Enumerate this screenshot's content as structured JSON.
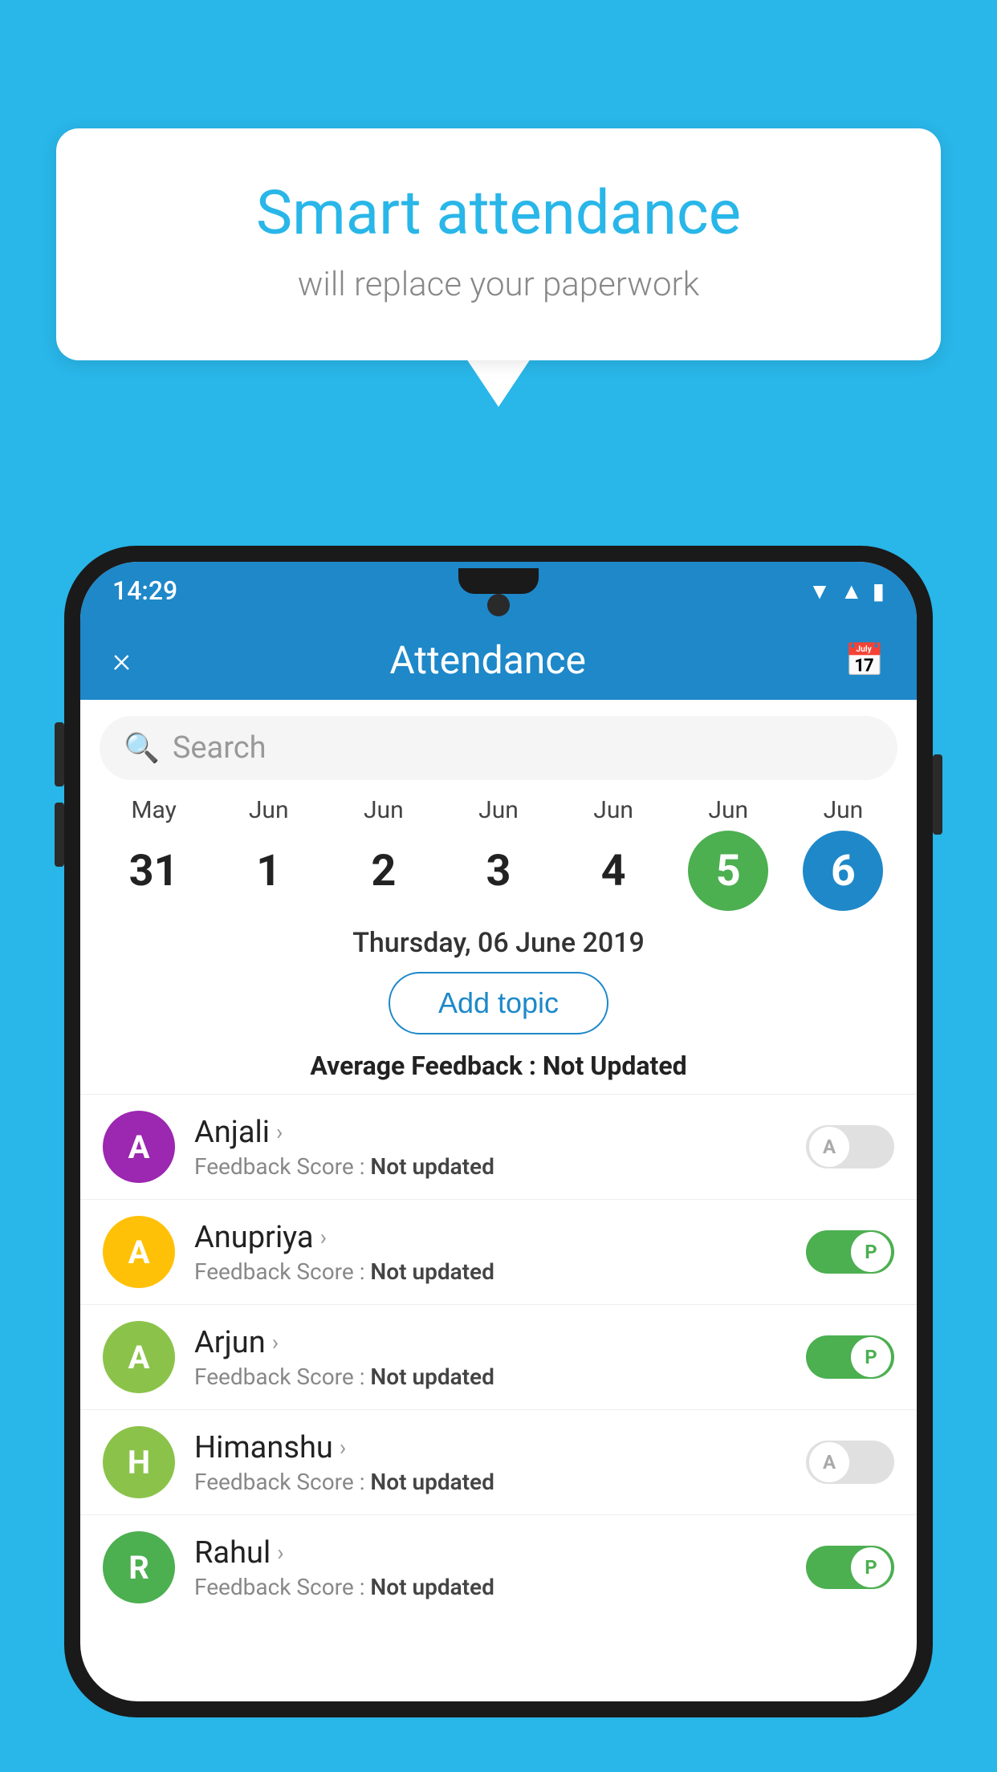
{
  "background_color": "#29b6e8",
  "speech_bubble": {
    "title": "Smart attendance",
    "subtitle": "will replace your paperwork"
  },
  "status_bar": {
    "time": "14:29",
    "icons": [
      "wifi",
      "signal",
      "battery"
    ]
  },
  "app_header": {
    "title": "Attendance",
    "close_label": "×",
    "calendar_label": "📅"
  },
  "search": {
    "placeholder": "Search"
  },
  "calendar": {
    "dates": [
      {
        "month": "May",
        "day": "31",
        "state": "normal"
      },
      {
        "month": "Jun",
        "day": "1",
        "state": "normal"
      },
      {
        "month": "Jun",
        "day": "2",
        "state": "normal"
      },
      {
        "month": "Jun",
        "day": "3",
        "state": "normal"
      },
      {
        "month": "Jun",
        "day": "4",
        "state": "normal"
      },
      {
        "month": "Jun",
        "day": "5",
        "state": "today"
      },
      {
        "month": "Jun",
        "day": "6",
        "state": "selected"
      }
    ]
  },
  "selected_date_label": "Thursday, 06 June 2019",
  "add_topic_label": "Add topic",
  "avg_feedback": {
    "label": "Average Feedback : ",
    "value": "Not Updated"
  },
  "students": [
    {
      "name": "Anjali",
      "avatar_letter": "A",
      "avatar_color": "#9c27b0",
      "feedback": "Not updated",
      "attendance": "absent"
    },
    {
      "name": "Anupriya",
      "avatar_letter": "A",
      "avatar_color": "#ffc107",
      "feedback": "Not updated",
      "attendance": "present"
    },
    {
      "name": "Arjun",
      "avatar_letter": "A",
      "avatar_color": "#8bc34a",
      "feedback": "Not updated",
      "attendance": "present"
    },
    {
      "name": "Himanshu",
      "avatar_letter": "H",
      "avatar_color": "#8bc34a",
      "feedback": "Not updated",
      "attendance": "absent"
    },
    {
      "name": "Rahul",
      "avatar_letter": "R",
      "avatar_color": "#4caf50",
      "feedback": "Not updated",
      "attendance": "present"
    }
  ]
}
